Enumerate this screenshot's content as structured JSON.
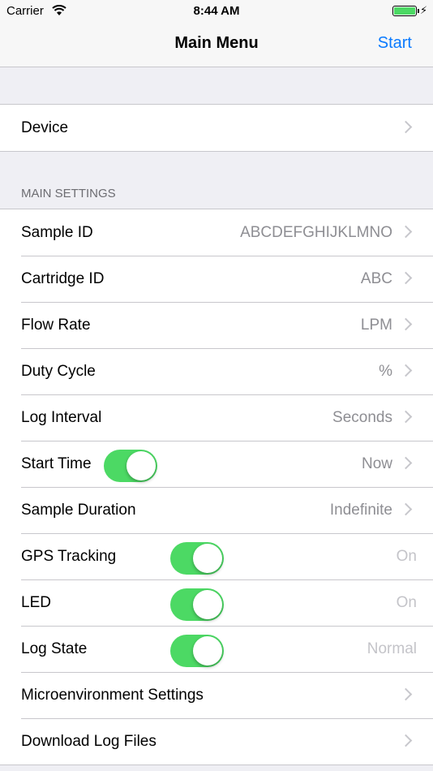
{
  "status_bar": {
    "carrier": "Carrier",
    "time": "8:44 AM",
    "battery_color": "#4cd964"
  },
  "nav": {
    "title": "Main Menu",
    "start_label": "Start",
    "accent": "#0a7aff"
  },
  "device_section": {
    "label": "Device"
  },
  "main_settings": {
    "header": "MAIN SETTINGS",
    "rows": [
      {
        "label": "Sample ID",
        "value": "ABCDEFGHIJKLMNO"
      },
      {
        "label": "Cartridge ID",
        "value": "ABC"
      },
      {
        "label": "Flow Rate",
        "value": "LPM"
      },
      {
        "label": "Duty Cycle",
        "value": "%"
      },
      {
        "label": "Log Interval",
        "value": "Seconds"
      },
      {
        "label": "Start Time",
        "value": "Now",
        "toggle": true
      },
      {
        "label": "Sample Duration",
        "value": "Indefinite"
      },
      {
        "label": "GPS Tracking",
        "value": "On",
        "toggle": true
      },
      {
        "label": "LED",
        "value": "On",
        "toggle": true
      },
      {
        "label": "Log State",
        "value": "Normal",
        "toggle": true
      },
      {
        "label": "Microenvironment Settings",
        "value": ""
      },
      {
        "label": "Download Log Files",
        "value": ""
      }
    ]
  }
}
